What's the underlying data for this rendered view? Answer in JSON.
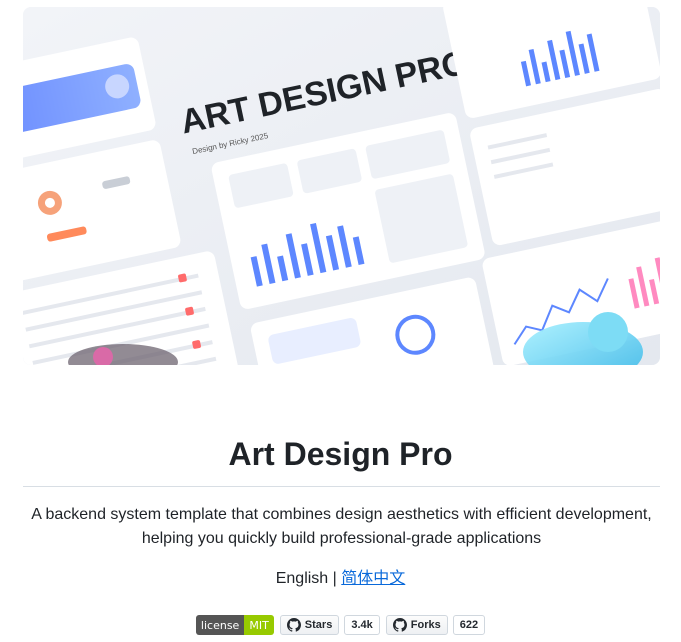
{
  "hero": {
    "headline": "ART DESIGN PRO",
    "byline": "Design by  Ricky  2025"
  },
  "title": "Art Design Pro",
  "description": "A backend system template that combines design aesthetics with efficient development, helping you quickly build professional-grade applications",
  "language": {
    "current": "English",
    "separator": "|",
    "alternate": "简体中文"
  },
  "badges": {
    "license_label": "license",
    "license_value": "MIT",
    "stars_label": "Stars",
    "stars_count": "3.4k",
    "forks_label": "Forks",
    "forks_count": "622"
  },
  "colors": {
    "link": "#0969da",
    "license_green": "#97ca00",
    "accent_blue": "#5d87ff"
  }
}
